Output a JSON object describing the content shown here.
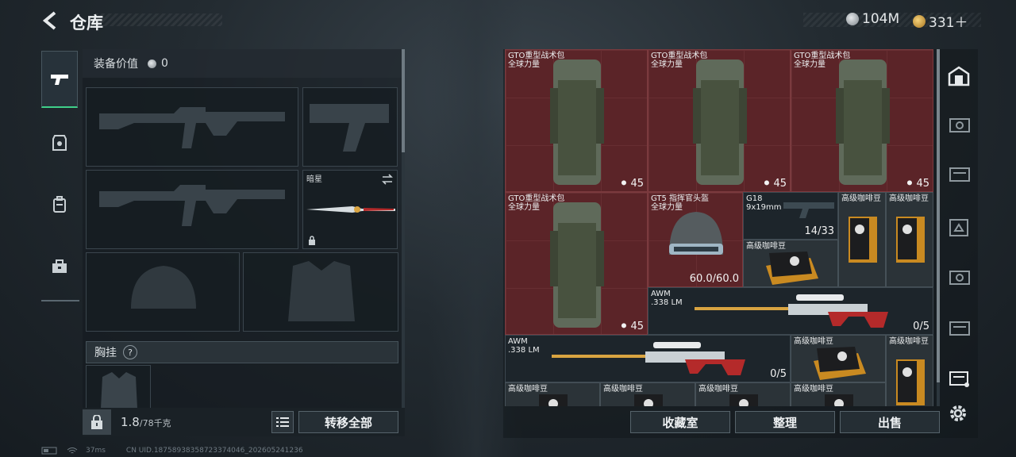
{
  "header": {
    "title": "仓库",
    "currency1": "104M",
    "currency2": "331＋"
  },
  "loadout": {
    "value_label": "装备价值",
    "value": "0",
    "melee_label": "暗星",
    "chest_label": "胸挂",
    "chest_help": "?"
  },
  "bottom": {
    "weight_value": "1.8",
    "weight_max": "/78千克",
    "transfer_all": "转移全部",
    "collection": "收藏室",
    "organize": "整理",
    "sell": "出售"
  },
  "items": [
    {
      "name": "GTO重型战术包",
      "sub": "全球力量",
      "count": "45"
    },
    {
      "name": "GTO重型战术包",
      "sub": "全球力量",
      "count": "45"
    },
    {
      "name": "GTO重型战术包",
      "sub": "全球力量",
      "count": "45"
    },
    {
      "name": "GTO重型战术包",
      "sub": "全球力量",
      "count": "45"
    },
    {
      "name": "GT5 指挥官头盔",
      "sub": "全球力量",
      "count": "60.0/60.0"
    },
    {
      "name": "G18",
      "sub": "9x19mm",
      "count": "14/33"
    },
    {
      "name": "高级咖啡豆",
      "sub": "",
      "count": ""
    },
    {
      "name": "高级咖啡豆",
      "sub": "",
      "count": ""
    },
    {
      "name": "高级咖啡豆",
      "sub": "",
      "count": ""
    },
    {
      "name": "AWM",
      "sub": ".338 LM",
      "count": "0/5"
    },
    {
      "name": "AWM",
      "sub": ".338 LM",
      "count": "0/5"
    },
    {
      "name": "高级咖啡豆",
      "sub": "",
      "count": ""
    },
    {
      "name": "高级咖啡豆",
      "sub": "",
      "count": ""
    },
    {
      "name": "高级咖啡豆",
      "sub": "",
      "count": ""
    },
    {
      "name": "高级咖啡豆",
      "sub": "",
      "count": ""
    },
    {
      "name": "高级咖啡豆",
      "sub": "",
      "count": ""
    },
    {
      "name": "高级咖啡豆",
      "sub": "",
      "count": ""
    }
  ],
  "status": {
    "ping": "37ms",
    "uid": "CN UID.18758938358723374046_202605241236"
  },
  "colors": {
    "accent": "#3fd08a",
    "item_red": "#5b2428",
    "coin1": "#b8bec3",
    "coin2": "#d9a441"
  },
  "icons": [
    "back-arrow-icon",
    "pistol-icon",
    "armor-icon",
    "backpack-icon",
    "toolbox-icon",
    "lock-icon",
    "list-icon",
    "safe-icon",
    "gear-icon",
    "wifi-icon",
    "battery-icon"
  ]
}
